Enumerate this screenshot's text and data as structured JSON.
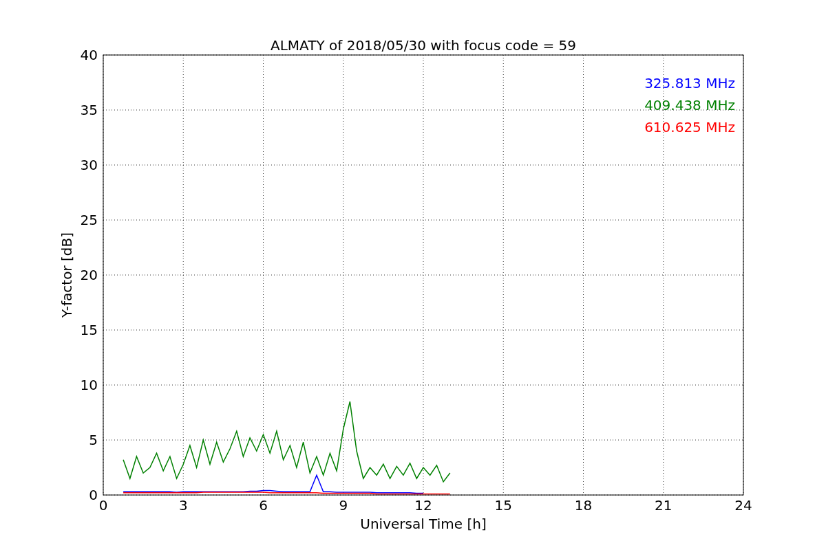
{
  "figure": {
    "chart_data": {
      "type": "line",
      "title": "ALMATY of 2018/05/30 with focus code = 59",
      "xlabel": "Universal Time [h]",
      "ylabel": "Y-factor [dB]",
      "x": [
        0.75,
        1.0,
        1.25,
        1.5,
        1.75,
        2.0,
        2.25,
        2.5,
        2.75,
        3.0,
        3.25,
        3.5,
        3.75,
        4.0,
        4.25,
        4.5,
        4.75,
        5.0,
        5.25,
        5.5,
        5.75,
        6.0,
        6.25,
        6.5,
        6.75,
        7.0,
        7.25,
        7.5,
        7.75,
        8.0,
        8.25,
        8.5,
        8.75,
        9.0,
        9.25,
        9.5,
        9.75,
        10.0,
        10.25,
        10.5,
        10.75,
        11.0,
        11.25,
        11.5,
        11.75,
        12.0,
        12.25,
        12.5,
        12.75,
        13.0
      ],
      "series": [
        {
          "name": "325.813 MHz",
          "color": "#0000ff",
          "values": [
            0.3,
            0.3,
            0.3,
            0.3,
            0.3,
            0.3,
            0.3,
            0.3,
            0.25,
            0.3,
            0.3,
            0.3,
            0.3,
            0.3,
            0.3,
            0.3,
            0.3,
            0.3,
            0.3,
            0.35,
            0.35,
            0.4,
            0.4,
            0.35,
            0.3,
            0.3,
            0.3,
            0.3,
            0.3,
            1.8,
            0.3,
            0.3,
            0.25,
            0.25,
            0.25,
            0.25,
            0.25,
            0.25,
            0.2,
            0.2,
            0.2,
            0.2,
            0.2,
            0.2,
            0.15,
            0.15,
            null,
            null,
            null,
            null
          ]
        },
        {
          "name": "409.438 MHz",
          "color": "#008000",
          "values": [
            3.2,
            1.5,
            3.5,
            2.0,
            2.5,
            3.8,
            2.2,
            3.5,
            1.5,
            2.8,
            4.5,
            2.5,
            5.0,
            2.8,
            4.8,
            3.0,
            4.2,
            5.8,
            3.5,
            5.2,
            4.0,
            5.5,
            3.8,
            5.8,
            3.2,
            4.5,
            2.5,
            4.8,
            2.0,
            3.5,
            1.8,
            3.8,
            2.2,
            6.0,
            8.5,
            4.0,
            1.5,
            2.5,
            1.8,
            2.8,
            1.5,
            2.6,
            1.8,
            2.9,
            1.5,
            2.5,
            1.8,
            2.7,
            1.2,
            2.0
          ]
        },
        {
          "name": "610.625 MHz",
          "color": "#ff0000",
          "values": [
            0.2,
            0.2,
            0.2,
            0.2,
            0.2,
            0.2,
            0.2,
            0.2,
            0.2,
            0.2,
            0.2,
            0.2,
            0.25,
            0.25,
            0.25,
            0.25,
            0.25,
            0.25,
            0.25,
            0.25,
            0.25,
            0.25,
            0.2,
            0.2,
            0.2,
            0.2,
            0.2,
            0.2,
            0.2,
            0.2,
            0.15,
            0.15,
            0.15,
            0.15,
            0.15,
            0.15,
            0.15,
            0.15,
            0.1,
            0.1,
            0.1,
            0.1,
            0.1,
            0.1,
            0.1,
            0.1,
            0.1,
            0.1,
            0.1,
            0.1
          ]
        }
      ],
      "grid": true,
      "xlim": [
        0,
        24
      ],
      "ylim": [
        0,
        40
      ],
      "xticks": [
        0,
        3,
        6,
        9,
        12,
        15,
        18,
        21,
        24
      ],
      "yticks": [
        0,
        5,
        10,
        15,
        20,
        25,
        30,
        35,
        40
      ]
    }
  }
}
